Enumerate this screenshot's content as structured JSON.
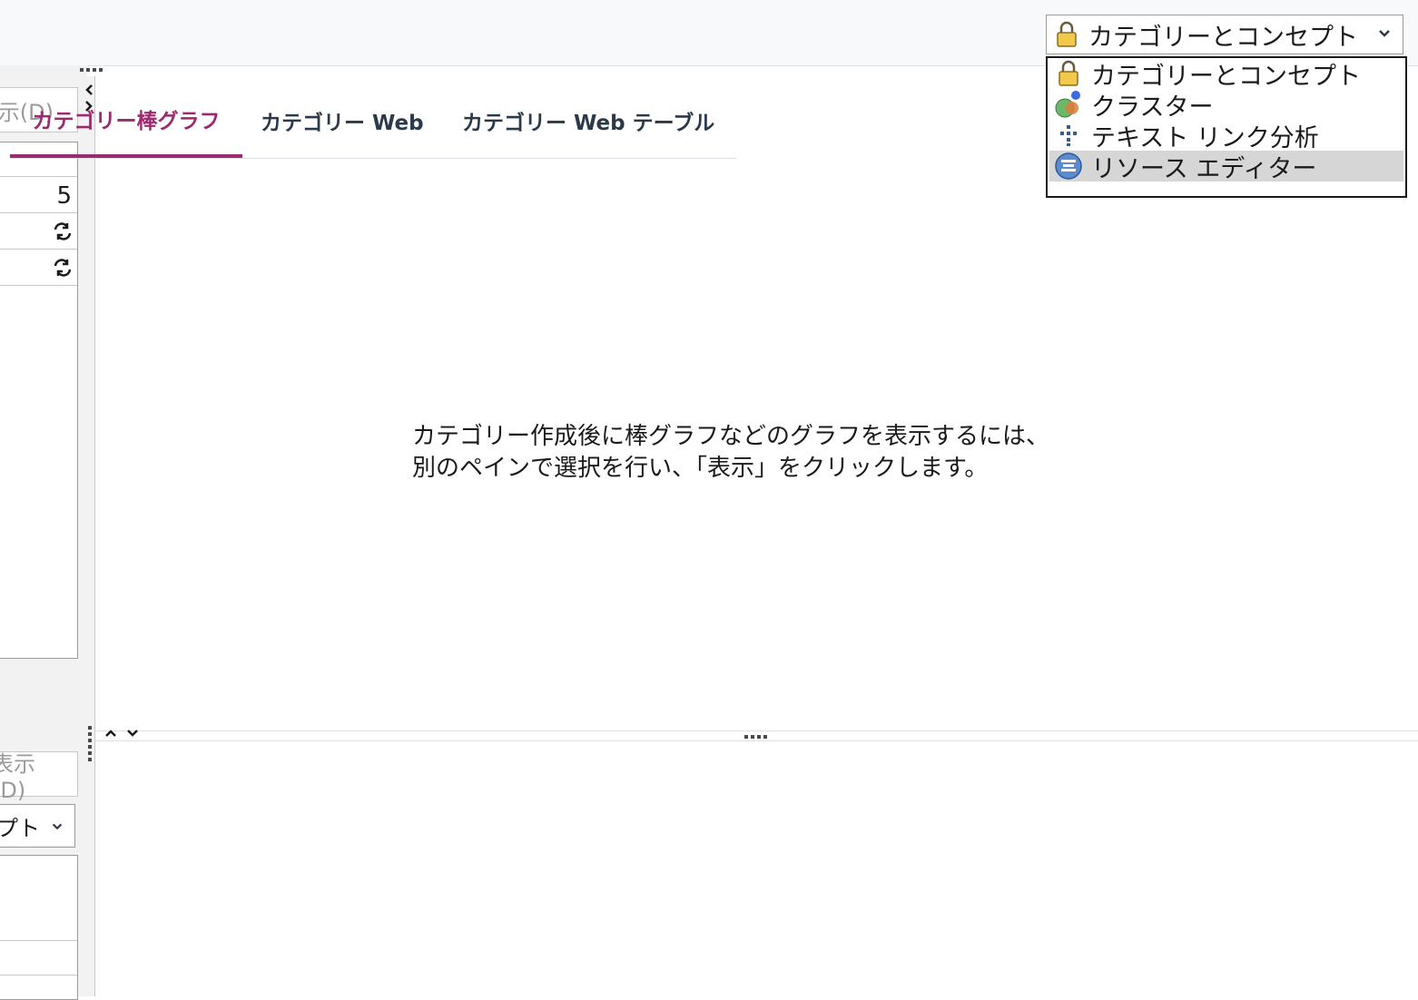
{
  "view_selector": {
    "selected": "カテゴリーとコンセプト",
    "options": [
      {
        "label": "カテゴリーとコンセプト",
        "icon": "lock-icon"
      },
      {
        "label": "クラスター",
        "icon": "cluster-icon"
      },
      {
        "label": "テキスト リンク分析",
        "icon": "link-analysis-icon"
      },
      {
        "label": "リソース エディター",
        "icon": "resource-editor-icon"
      }
    ],
    "highlighted_index": 3
  },
  "left_pane": {
    "display_button_top": "示(D)",
    "display_button_bottom": "表示(D)",
    "count": "5",
    "select_value": "プト"
  },
  "tabs": [
    {
      "label": "カテゴリー棒グラフ",
      "active": true
    },
    {
      "label": "カテゴリー Web",
      "active": false
    },
    {
      "label": "カテゴリー Web テーブル",
      "active": false
    }
  ],
  "message_line1": "カテゴリー作成後に棒グラフなどのグラフを表示するには、",
  "message_line2": "別のペインで選択を行い、「表示」をクリックします。",
  "colors": {
    "accent": "#9c2a6e",
    "tab_text": "#2b3a4a",
    "highlight": "#d6d6d6"
  }
}
